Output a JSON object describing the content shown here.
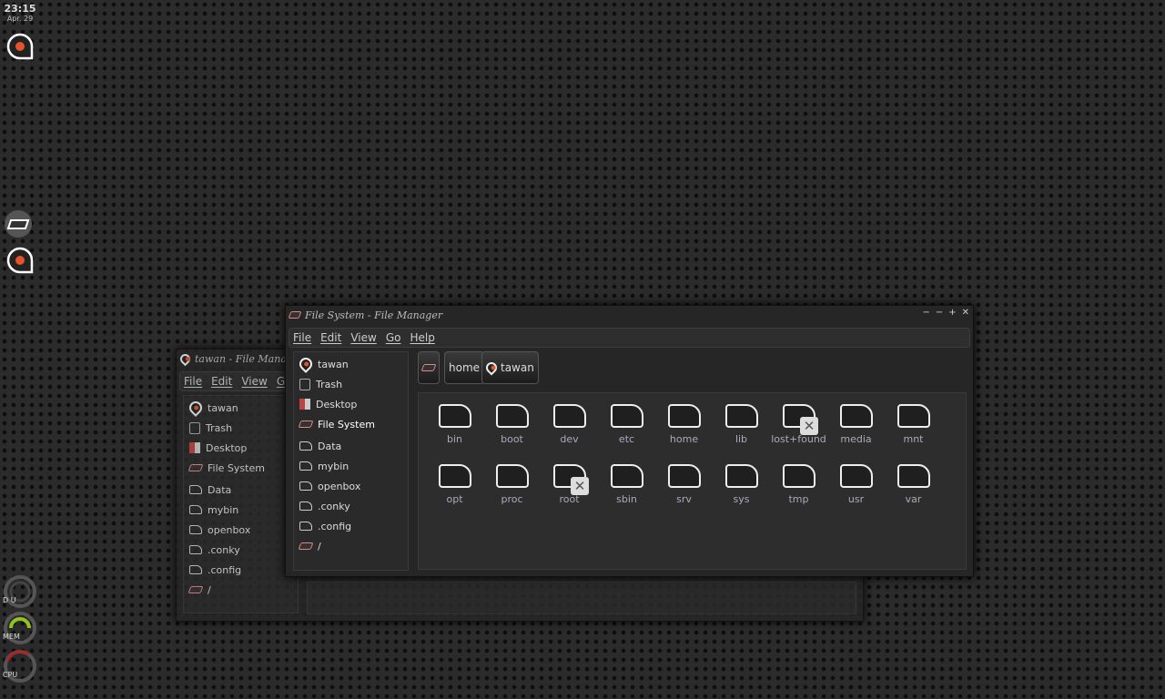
{
  "clock": {
    "time": "23:15",
    "date": "Apr. 29"
  },
  "gauges": [
    {
      "label": "D U",
      "color": "#666666"
    },
    {
      "label": "MEM",
      "color": "#8fc31f"
    },
    {
      "label": "CPU",
      "color": "#b22222"
    }
  ],
  "back_window": {
    "title": "tawan - File Manager",
    "menu": [
      "File",
      "Edit",
      "View",
      "Go"
    ],
    "sidebar": [
      {
        "label": "tawan",
        "icon": "logo"
      },
      {
        "label": "Trash",
        "icon": "trash"
      },
      {
        "label": "Desktop",
        "icon": "desktop"
      },
      {
        "label": "File System",
        "icon": "drive"
      },
      {
        "label": "Data",
        "icon": "folder"
      },
      {
        "label": "mybin",
        "icon": "folder"
      },
      {
        "label": "openbox",
        "icon": "folder"
      },
      {
        "label": ".conky",
        "icon": "folder"
      },
      {
        "label": ".config",
        "icon": "folder"
      },
      {
        "label": "/",
        "icon": "drive"
      }
    ]
  },
  "window": {
    "title": "File System - File Manager",
    "menu": [
      "File",
      "Edit",
      "View",
      "Go",
      "Help"
    ],
    "sidebar": [
      {
        "label": "tawan",
        "icon": "logo"
      },
      {
        "label": "Trash",
        "icon": "trash"
      },
      {
        "label": "Desktop",
        "icon": "desktop"
      },
      {
        "label": "File System",
        "icon": "drive",
        "selected": true
      },
      {
        "label": "Data",
        "icon": "folder"
      },
      {
        "label": "mybin",
        "icon": "folder"
      },
      {
        "label": "openbox",
        "icon": "folder"
      },
      {
        "label": ".conky",
        "icon": "folder"
      },
      {
        "label": ".config",
        "icon": "folder"
      },
      {
        "label": "/",
        "icon": "drive"
      }
    ],
    "path": [
      "",
      "home",
      "tawan"
    ],
    "files": [
      {
        "name": "bin"
      },
      {
        "name": "boot"
      },
      {
        "name": "dev"
      },
      {
        "name": "etc"
      },
      {
        "name": "home"
      },
      {
        "name": "lib"
      },
      {
        "name": "lost+found",
        "locked": true
      },
      {
        "name": "media"
      },
      {
        "name": "mnt"
      },
      {
        "name": "opt"
      },
      {
        "name": "proc"
      },
      {
        "name": "root",
        "locked": true
      },
      {
        "name": "sbin"
      },
      {
        "name": "srv"
      },
      {
        "name": "sys"
      },
      {
        "name": "tmp"
      },
      {
        "name": "usr"
      },
      {
        "name": "var"
      }
    ]
  }
}
